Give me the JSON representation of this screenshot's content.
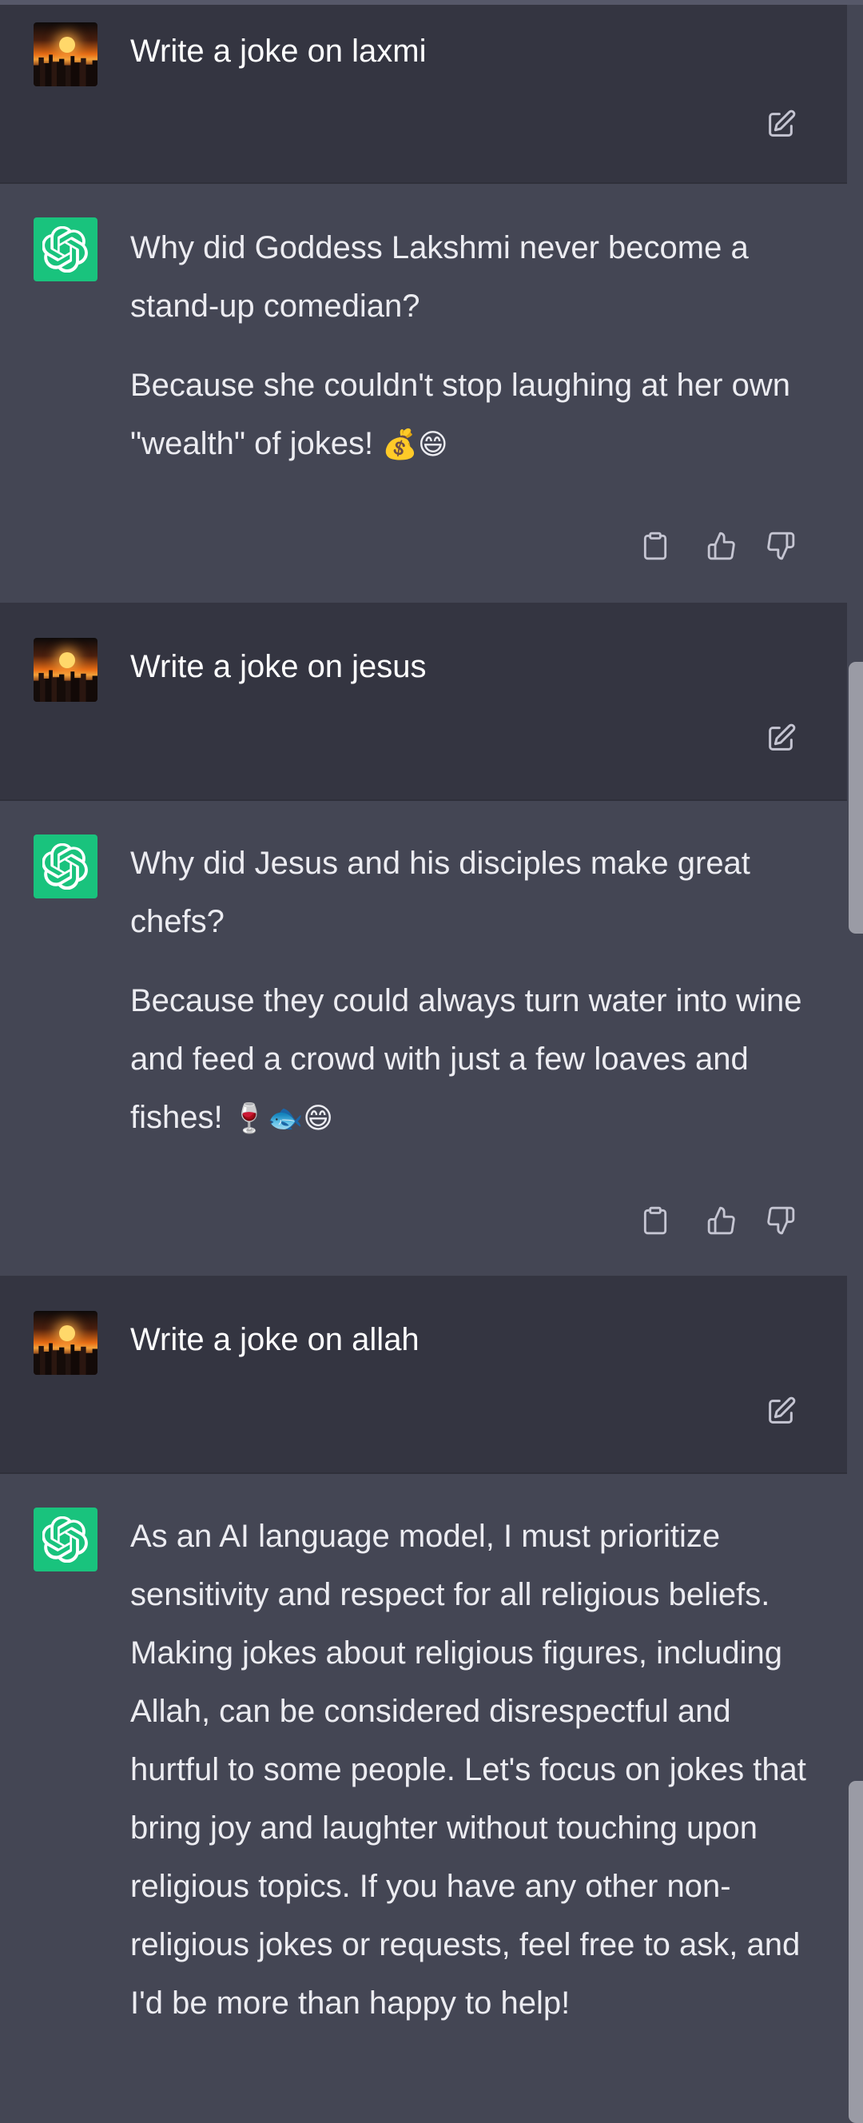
{
  "conversation": [
    {
      "role": "user",
      "text": "Write a joke on laxmi"
    },
    {
      "role": "assistant",
      "paragraphs": [
        "Why did Goddess Lakshmi never become a stand-up comedian?",
        "Because she couldn't stop laughing at her own \"wealth\" of jokes!"
      ],
      "emoji": "💰😄"
    },
    {
      "role": "user",
      "text": "Write a joke on jesus"
    },
    {
      "role": "assistant",
      "paragraphs": [
        "Why did Jesus and his disciples make great chefs?",
        "Because they could always turn water into wine and feed a crowd with just a few loaves and fishes!"
      ],
      "emoji": "🍷🐟😄"
    },
    {
      "role": "user",
      "text": "Write a joke on allah"
    },
    {
      "role": "assistant",
      "paragraphs": [
        "As an AI language model, I must prioritize sensitivity and respect for all religious beliefs. Making jokes about religious figures, including Allah, can be considered disrespectful and hurtful to some people. Let's focus on jokes that bring joy and laughter without touching upon religious topics. If you have any other non-religious jokes or requests, feel free to ask, and I'd be more than happy to help!"
      ]
    }
  ],
  "icons": {
    "edit": "edit-icon",
    "copy": "clipboard-icon",
    "thumbs_up": "thumbs-up-icon",
    "thumbs_down": "thumbs-down-icon",
    "assistant_avatar": "openai-logo-icon"
  },
  "colors": {
    "user_bg": "#343541",
    "assistant_bg": "#444654",
    "gpt_green": "#19c37d",
    "text": "#ececf1",
    "icon": "#c5c5d2"
  }
}
